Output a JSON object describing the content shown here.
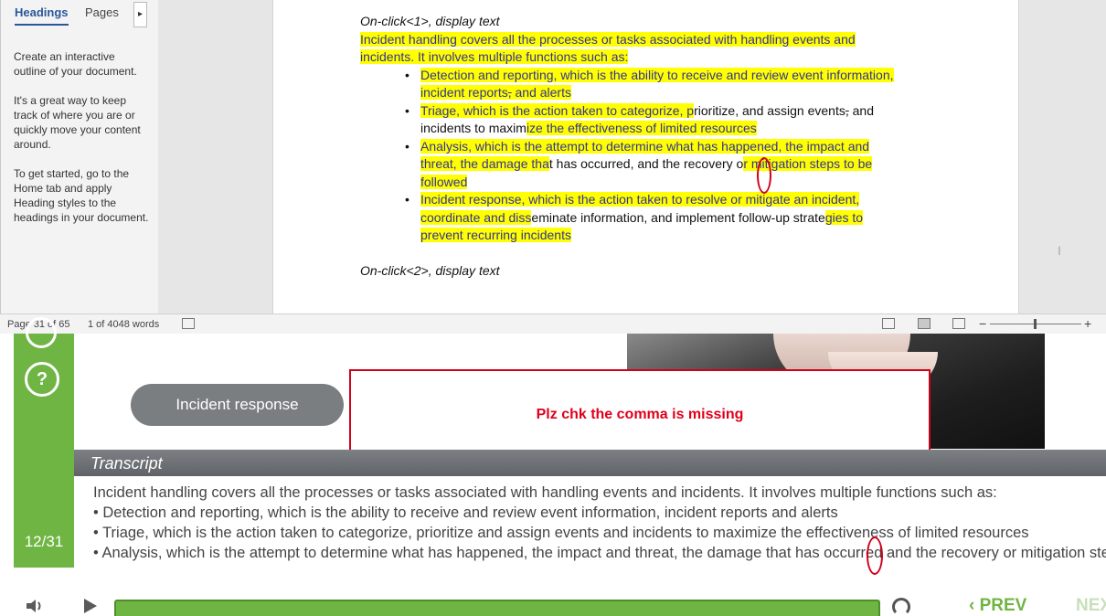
{
  "word": {
    "nav_pane": {
      "tabs": [
        "Headings",
        "Pages"
      ],
      "more_arrow": "▸",
      "help_paragraphs": [
        "Create an interactive outline of your document.",
        "It's a great way to keep track of where you are or quickly move your content around.",
        "To get started, go to the Home tab and apply Heading styles to the headings in your document."
      ]
    },
    "document": {
      "onclick1": "On-click<1>, display text",
      "intro_a": "Incident handling covers all the processes or tasks associated with handling events and",
      "intro_b": "incidents. It involves multiple functions such as:",
      "bullets": [
        {
          "line1": "Detection and reporting, which is the ability to receive and review event information,",
          "line2_hl": "incident reports",
          "line2_strike": ",",
          "line2_rest": " and alerts"
        },
        {
          "line1_hl": "Triage, which is the action taken to categorize, p",
          "line1_plain": "rioritize, and assign events",
          "line1_strike": ",",
          "line1_tail": " and",
          "line2_plain": "incidents to maxim",
          "line2_hl": "ize the effectiveness of limited resources"
        },
        {
          "line1": "Analysis, which is the attempt to determine what has happened, the impact and",
          "line2_hl": "threat, the damage tha",
          "line2_plain": "t has occurred, and the recovery o",
          "line2_hl2": "r mitigation steps to be",
          "line3_hl": "followed"
        },
        {
          "line1": "Incident response, which is the action taken to resolve or mitigate an incident,",
          "line2_hl": "coordinate and diss",
          "line2_plain": "eminate information, and implement follow-up strate",
          "line2_hl2": "gies to",
          "line3_hl": "prevent recurring incidents"
        }
      ],
      "onclick2": "On-click<2>, display text"
    },
    "statusbar": {
      "page": "Page 31 of 65",
      "words": "1 of 4048 words",
      "zoom_minus": "−",
      "zoom_plus": "+"
    }
  },
  "player": {
    "help_symbol": "?",
    "page_count": "12/31",
    "button_label": "Incident response",
    "comment": "Plz chk the comma is missing",
    "transcript_title": "Transcript",
    "transcript_lines": [
      "Incident handling covers all the processes or tasks associated with handling events and incidents. It involves multiple functions such as:",
      "• Detection and reporting, which is the ability to receive and review event information, incident reports and alerts",
      "• Triage, which is the action taken to categorize, prioritize and assign events and incidents to maximize the effectiveness of limited resources",
      "• Analysis, which is the attempt to determine what has happened, the impact and threat, the damage that has occurred and the recovery or mitigation steps"
    ],
    "prev_label": "‹ PREV",
    "next_label": "NEXT",
    "colors": {
      "accent_green": "#6fb544",
      "annotation_red": "#d0021b",
      "highlight": "#ffff00"
    }
  }
}
